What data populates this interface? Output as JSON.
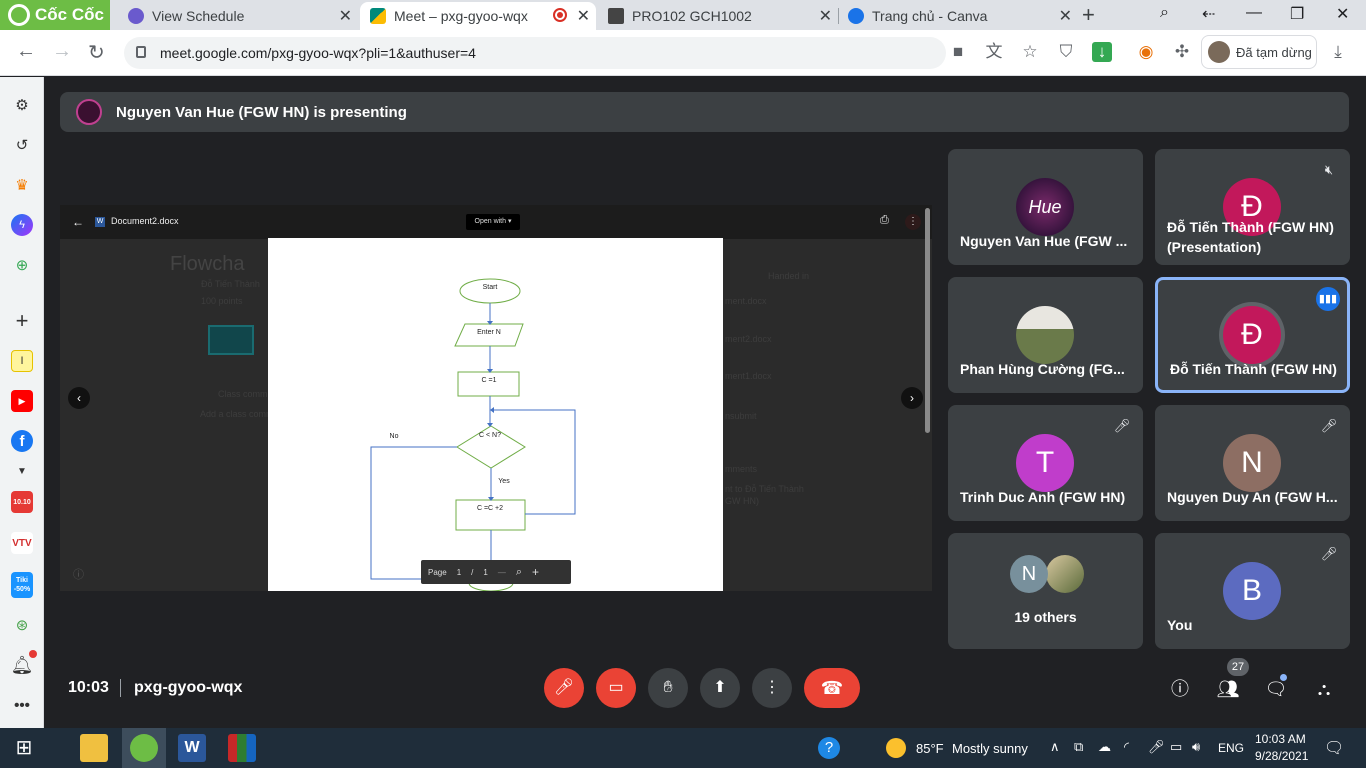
{
  "browser": {
    "brand": "Cốc Cốc",
    "tabs": [
      {
        "title": "View Schedule",
        "active": false,
        "favicon_color": "#6a5acd"
      },
      {
        "title": "Meet – pxg-gyoo-wqx",
        "active": true,
        "favicon_color": "#00897b"
      },
      {
        "title": "PRO102 GCH1002",
        "active": false,
        "favicon_color": "#444444"
      },
      {
        "title": "Trang chủ - Canva",
        "active": false,
        "favicon_color": "#1a73e8"
      }
    ],
    "url": "meet.google.com/pxg-gyoo-wqx?pli=1&authuser=4",
    "profile_status": "Đã tạm dừng"
  },
  "sidebar": {
    "icons": [
      "gear-icon",
      "history-icon",
      "crown-icon",
      "messenger-icon",
      "gamepad-icon",
      "plus-icon",
      "note-icon",
      "youtube-icon",
      "facebook-icon",
      "chevron-down-icon",
      "shop-1010-icon",
      "vtv-go-icon",
      "tiki-icon",
      "location-icon",
      "bell-icon",
      "more-icon"
    ],
    "tiki_label": "Tiki -50%",
    "shop_label": "10.10"
  },
  "meet": {
    "presenting_banner": "Nguyen Van Hue (FGW HN) is presenting",
    "shared_screen": {
      "doc_name": "Document2.docx",
      "open_with": "Open with",
      "pager": {
        "page_label": "Page",
        "current": "1",
        "sep": "/",
        "total": "1"
      },
      "flowchart": {
        "start": "Start",
        "input": "Enter N",
        "init": "C =1",
        "decision": "C < N?",
        "yes": "Yes",
        "no": "No",
        "step": "C =C +2"
      },
      "background_text": {
        "title": "Flowcha",
        "sub1": "Đỗ Tiến Thành",
        "sub2": "100 points",
        "handed_in": "Handed in",
        "file1": "ment.docx",
        "file2": "ment2.docx",
        "file3": "ment1.docx",
        "unsubmit": "nsubmit",
        "class_comments": "Class comm",
        "add_comment": "Add a class comm",
        "private_comments": "mments",
        "private_to": "nt to Đỗ Tiến Thành",
        "private_to2": "GW HN)"
      }
    },
    "participants": [
      {
        "name": "Nguyen Van Hue (FGW ...",
        "initial": "",
        "color": "#3a1030",
        "muted": false,
        "speaking": false,
        "photo": true
      },
      {
        "name": "Đỗ Tiến Thành (FGW HN) (Presentation)",
        "initial": "Đ",
        "color": "#c2185b",
        "muted": true,
        "speaking": false
      },
      {
        "name": "Phan Hùng Cường (FG...",
        "initial": "",
        "color": "#8b7a5a",
        "muted": false,
        "speaking": false,
        "photo": true
      },
      {
        "name": "Đỗ Tiến Thành (FGW HN)",
        "initial": "Đ",
        "color": "#c2185b",
        "muted": false,
        "speaking": true
      },
      {
        "name": "Trinh Duc Anh (FGW HN)",
        "initial": "T",
        "color": "#c03dcb",
        "muted": true,
        "speaking": false
      },
      {
        "name": "Nguyen Duy An (FGW H...",
        "initial": "N",
        "color": "#8d6e63",
        "muted": true,
        "speaking": false
      },
      {
        "name": "19 others",
        "initial": "N",
        "color": "#78909c",
        "muted": false,
        "speaking": false
      },
      {
        "name": "You",
        "initial": "B",
        "color": "#5c6bc0",
        "muted": true,
        "speaking": false
      }
    ],
    "bottom": {
      "time": "10:03",
      "meeting_code": "pxg-gyoo-wqx",
      "participant_count": "27"
    }
  },
  "taskbar": {
    "weather_temp": "85°F",
    "weather_desc": "Mostly sunny",
    "language": "ENG",
    "time": "10:03 AM",
    "date": "9/28/2021"
  }
}
